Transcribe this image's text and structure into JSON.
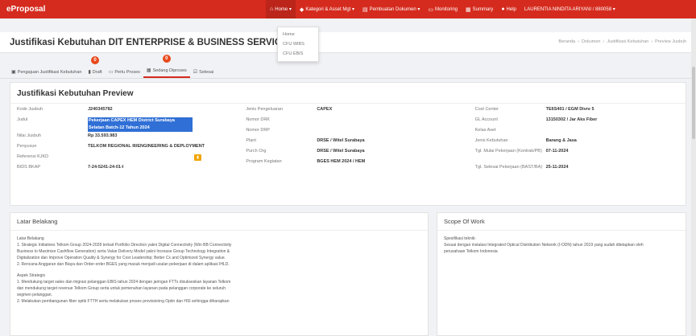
{
  "brand": "eProposal",
  "nav": {
    "items": [
      {
        "icon": "home-icon",
        "glyph": "⌂",
        "label": "Home ▾"
      },
      {
        "icon": "tag-icon",
        "glyph": "◆",
        "label": "Kategori & Asset Mgt ▾"
      },
      {
        "icon": "doc-icon",
        "glyph": "▤",
        "label": "Pembuatan Dokumen ▾"
      },
      {
        "icon": "monitor-icon",
        "glyph": "▭",
        "label": "Monitoring"
      },
      {
        "icon": "summary-icon",
        "glyph": "▦",
        "label": "Summary"
      },
      {
        "icon": "help-icon",
        "glyph": "●",
        "label": "Help"
      }
    ],
    "user": "LAURENTIA NINDITA ARIYANI / 880058 ▾"
  },
  "home_dropdown": [
    "Home",
    "CFU WIBS",
    "CFU EBIS"
  ],
  "page_title": "Justifikasi Kebutuhan DIT ENTERPRISE & BUSINESS SERVICE",
  "breadcrumb": [
    "Beranda",
    "›",
    "Dokumen",
    "›",
    "Justifikasi Kebutuhan",
    "›",
    "Preview Jusbuh"
  ],
  "tabs": [
    {
      "label": "Pengajuan Justifikasi Kebutuhan",
      "badge": ""
    },
    {
      "label": "Draft",
      "badge": "0"
    },
    {
      "label": "Perlu Proses",
      "badge": ""
    },
    {
      "label": "Sedang Diproses",
      "badge": "0"
    },
    {
      "label": "Selesai",
      "badge": ""
    }
  ],
  "preview": {
    "title": "Justifikasi Kebutuhan Preview",
    "left": [
      {
        "label": "Kode Jusbuh",
        "value": "J240345782"
      },
      {
        "label": "Judul",
        "value": "Pekerjaan CAPEX HEM District Surabaya Selatan Batch-12 Tahun 2024",
        "highlight": true
      },
      {
        "label": "Nilai Jusbuh",
        "value": "Rp 33.593.983"
      },
      {
        "label": "Penyusun",
        "value": "TELKOM REGIONAL III/ENGINEERING & DEPLOYMENT"
      },
      {
        "label": "Referensi KJKD",
        "value": ""
      },
      {
        "label": "BIDS BKAP",
        "value": "7-24-5241-24-01-I"
      }
    ],
    "middle": [
      {
        "label": "Jenis Pengeluaran",
        "value": "CAPEX"
      },
      {
        "label": "Nomor DRK",
        "value": ""
      },
      {
        "label": "Nomor DRP",
        "value": ""
      },
      {
        "label": "Plant",
        "value": "DRSE / Witel Surabaya"
      },
      {
        "label": "Purch Org",
        "value": "DRSE / Witel Surabaya"
      },
      {
        "label": "Program Kegiatan",
        "value": "BGES HEM 2024 / HEM"
      }
    ],
    "right": [
      {
        "label": "Cost Center",
        "value": "TE6S401 / EGM Divre 5"
      },
      {
        "label": "GL Account",
        "value": "13150302 / Jar Aks Fiber"
      },
      {
        "label": "Kelas Aset",
        "value": ""
      },
      {
        "label": "Jenis Kebutuhan",
        "value": "Barang & Jasa"
      },
      {
        "label": "Tgl. Mulai Pekerjaan (Kontrak/PB)",
        "value": "07-11-2024"
      },
      {
        "label": "Tgl. Selesai Pekerjaan (BAST/BA)",
        "value": "25-11-2024"
      }
    ]
  },
  "latar": {
    "title": "Latar Belakang",
    "lines": [
      "Latar Belakang",
      "1. Strategic Initiatives Telkom Group 2024-2028 terkait Portfolio Direction yakni Digital Connectivity (Win BB Connectivity",
      "Business to Maximize Cashflow Generation) serta Value Delivery Model yakni Increase Group Technology Integration &",
      "Digitalization dan Improve Operation Quality & Synergy for Cost Leadership; Better Cx and Optimized Synergy value.",
      "2. Rencana Anggaran dan Biaya dan Order-order BGES yang masuk menjadi usulan pekerjaan di dalam aplikasi IHLD.",
      "",
      "Aspek Strategis",
      "1. Mendukung target sales dan migrasi pelanggan EBIS tahun 2024 dengan jaringan FTTx disukseskan layanan Telkom",
      "dan mendukung target revenue Telkom Group serta untuk pemenuhan layanan pada pelanggan corporate ke seluruh",
      "segmen pelanggan.",
      "2. Melakukan pembangunan fiber optik FTTH serta melakukan proses provisioning Optin dan HSI sehingga diharapkan"
    ]
  },
  "scope": {
    "title": "Scope Of Work",
    "lines": [
      "Spesifikasi teknik:",
      "Sesuai dengan instalasi Integrated Optical Distribution Network (I-ODN) tahun 2019 yang sudah ditetapkan oleh",
      "perusahaan Telkom Indonesia"
    ]
  },
  "colors": {
    "brand": "#d52b1e",
    "badge": "#e8491d",
    "highlight": "#2f6fd6",
    "button": "#f0a500"
  }
}
